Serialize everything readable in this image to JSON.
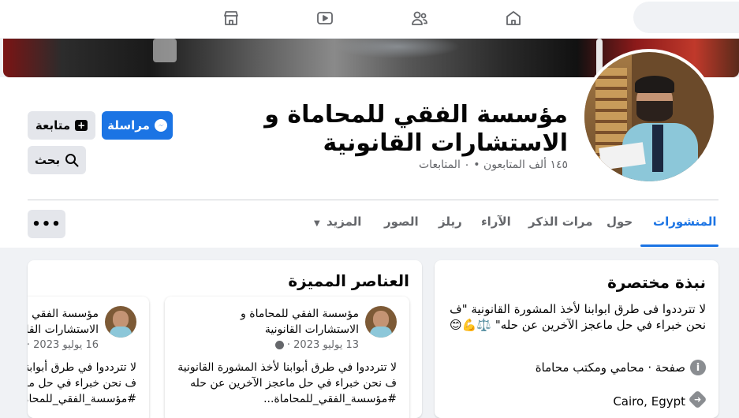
{
  "topnav": {
    "icons": [
      "marketplace-icon",
      "watch-icon",
      "groups-icon",
      "home-icon"
    ]
  },
  "profile": {
    "name": "مؤسسة الفقي للمحاماة و الاستشارات القانونية",
    "stats": "١٤٥ ألف المتابعون • ٠ المتابعات"
  },
  "actions": {
    "message_label": "مراسلة",
    "follow_label": "متابعة",
    "search_label": "بحث"
  },
  "tabs": [
    {
      "label": "المنشورات"
    },
    {
      "label": "حول"
    },
    {
      "label": "مرات الذكر"
    },
    {
      "label": "الآراء"
    },
    {
      "label": "ريلز"
    },
    {
      "label": "الصور"
    },
    {
      "label": "المزيد"
    }
  ],
  "more_menu_label": "•••",
  "intro": {
    "title": "نبذة مختصرة",
    "text": "لا تترددوا فى طرق ابوابنا لأخذ المشورة القانونية \"ف نحن خبراء في حل ماعجز الآخرين عن حله\"",
    "emojis": "⚖️💪😊",
    "category_text": "صفحة · محامي ومكتب محاماة",
    "location_text": "Cairo, Egypt"
  },
  "featured": {
    "title": "العناصر المميزة",
    "posts": [
      {
        "name": "مؤسسة الفقي للمحاماة و الاستشارات القانونية",
        "date": "13 يوليو 2023 ·",
        "body": "لا تترددوا في طرق أبوابنا لأخذ المشورة القانونية ف نحن خبراء في حل ماعجز الآخرين عن حله #مؤسسة_الفقي_للمحاماة..."
      },
      {
        "name": "مؤسسة الفقي للمحاماة و الاستشارات القانونية",
        "date": "16 يوليو 2023 ·",
        "body": "لا تترددوا في طرق أبوابنا لأخذ المشورة القانونية ف نحن خبراء في حل ماعجز الآخرين عن حله #مؤسسة_الفقي_للمحاماة..."
      }
    ]
  },
  "colors": {
    "accent": "#1b74e4",
    "background": "#f0f2f5",
    "muted_text": "#65676b"
  }
}
